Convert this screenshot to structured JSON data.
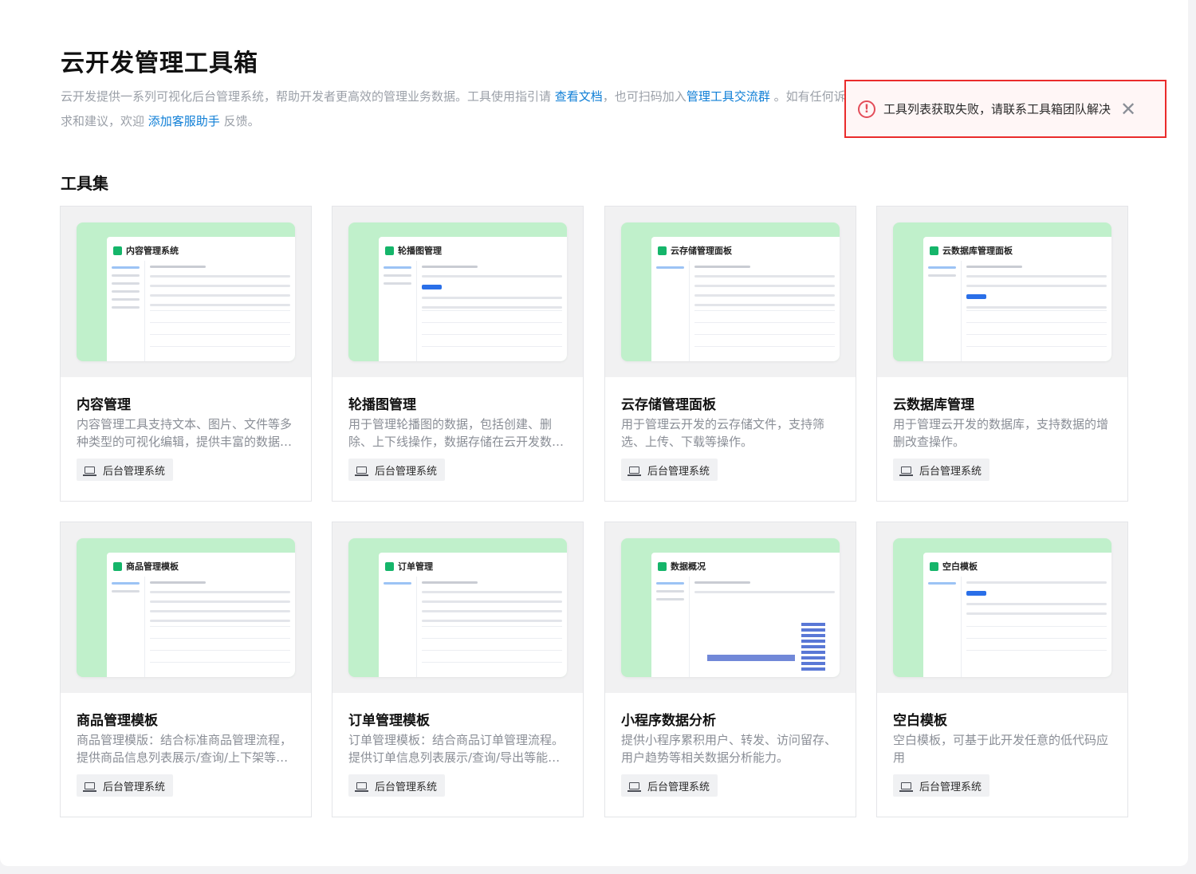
{
  "header": {
    "title": "云开发管理工具箱",
    "desc_part1": "云开发提供一系列可视化后台管理系统，帮助开发者更高效的管理业务数据。工具使用指引请 ",
    "docs_link": "查看文档",
    "desc_part2": "，也可扫码加入",
    "group_link": "管理工具交流群",
    "desc_part3": " 。如有任何诉求和建议，欢迎 ",
    "support_link": "添加客服助手",
    "desc_part4": " 反馈。"
  },
  "toast": {
    "message": "工具列表获取失败，请联系工具箱团队解决",
    "icon": "error-circle-icon",
    "close_icon": "close-icon"
  },
  "section_title": "工具集",
  "cards": [
    {
      "name": "内容管理",
      "desc": "内容管理工具支持文本、图片、文件等多种类型的可视化编辑，提供丰富的数据管理能力。",
      "tag": "后台管理系统",
      "preview_title": "内容管理系统"
    },
    {
      "name": "轮播图管理",
      "desc": "用于管理轮播图的数据，包括创建、删除、上下线操作，数据存储在云开发数据库中。",
      "tag": "后台管理系统",
      "preview_title": "轮播图管理"
    },
    {
      "name": "云存储管理面板",
      "desc": "用于管理云开发的云存储文件，支持筛选、上传、下载等操作。",
      "tag": "后台管理系统",
      "preview_title": "云存储管理面板"
    },
    {
      "name": "云数据库管理",
      "desc": "用于管理云开发的数据库，支持数据的增删改查操作。",
      "tag": "后台管理系统",
      "preview_title": "云数据库管理面板"
    },
    {
      "name": "商品管理模板",
      "desc": "商品管理模版：结合标准商品管理流程，提供商品信息列表展示/查询/上下架等能力。",
      "tag": "后台管理系统",
      "preview_title": "商品管理模板"
    },
    {
      "name": "订单管理模板",
      "desc": "订单管理模板：结合商品订单管理流程。提供订单信息列表展示/查询/导出等能力。",
      "tag": "后台管理系统",
      "preview_title": "订单管理"
    },
    {
      "name": "小程序数据分析",
      "desc": "提供小程序累积用户、转发、访问留存、用户趋势等相关数据分析能力。",
      "tag": "后台管理系统",
      "preview_title": "数据概况"
    },
    {
      "name": "空白模板",
      "desc": "空白模板，可基于此开发任意的低代码应用",
      "tag": "后台管理系统",
      "preview_title": "空白模板"
    }
  ],
  "colors": {
    "accent": "#0e7ed6",
    "error": "#ea2b2b",
    "preview_bg": "#c0f0cb"
  }
}
